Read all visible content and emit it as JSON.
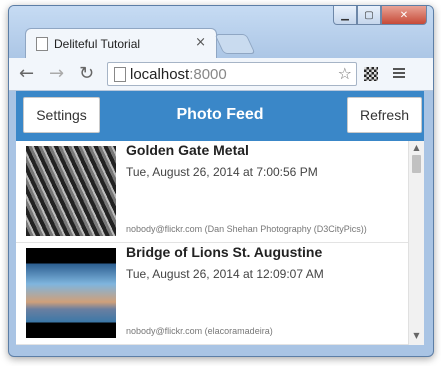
{
  "window": {
    "controls": {
      "minimize": "▁",
      "maximize": "▢",
      "close": "✕"
    }
  },
  "tab": {
    "title": "Deliteful Tutorial",
    "close": "×"
  },
  "toolbar": {
    "back": "←",
    "forward": "→",
    "reload": "↻",
    "url_host": "localhost",
    "url_port": ":8000",
    "star": "☆"
  },
  "app": {
    "title": "Photo Feed",
    "settings_label": "Settings",
    "refresh_label": "Refresh"
  },
  "feed": [
    {
      "title": "Golden Gate Metal",
      "date": "Tue, August 26, 2014 at 7:00:56 PM",
      "author": "nobody@flickr.com (Dan Shehan Photography (D3CityPics))"
    },
    {
      "title": "Bridge of Lions St. Augustine",
      "date": "Tue, August 26, 2014 at 12:09:07 AM",
      "author": "nobody@flickr.com (elacoramadeira)"
    }
  ],
  "scrollbar": {
    "up": "▲",
    "down": "▼"
  },
  "colors": {
    "appbar": "#3a87c8"
  }
}
